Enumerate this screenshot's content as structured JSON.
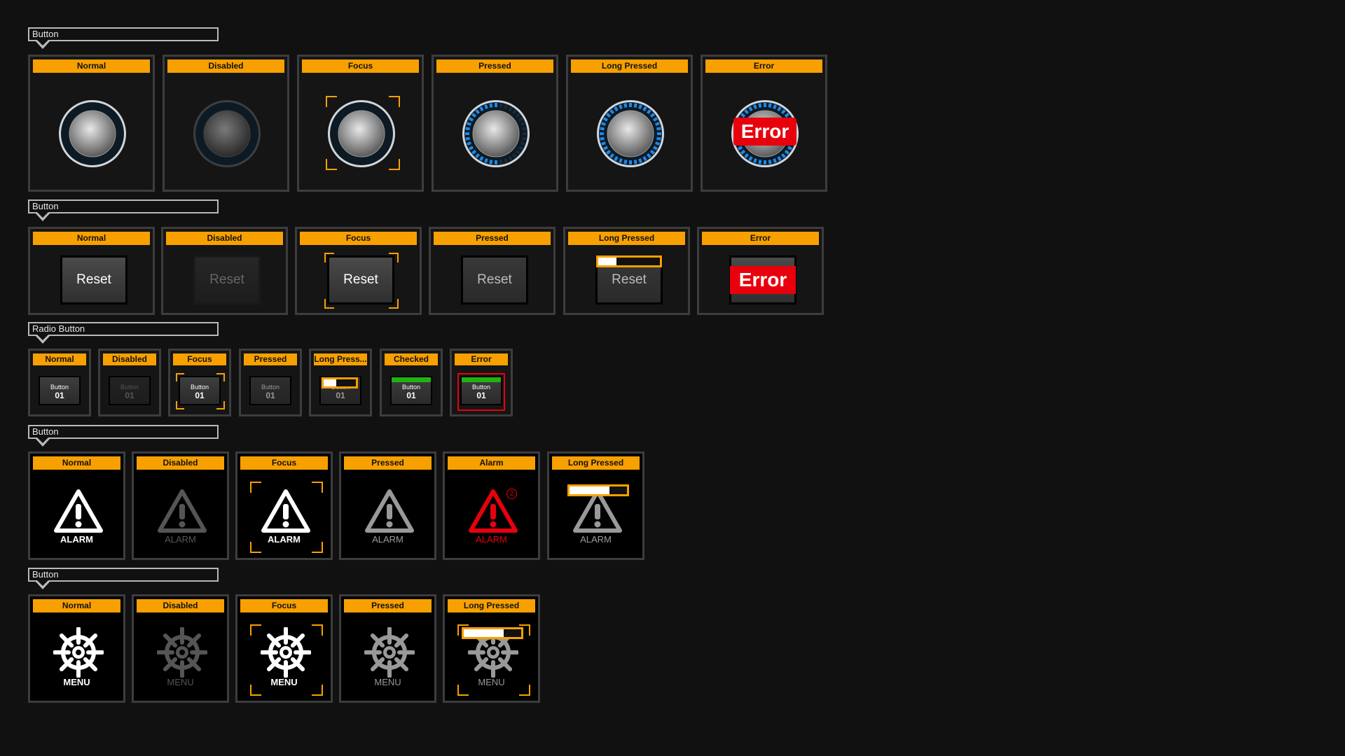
{
  "sections": [
    {
      "label": "Button"
    },
    {
      "label": "Button"
    },
    {
      "label": "Radio Button"
    },
    {
      "label": "Button"
    },
    {
      "label": "Button"
    }
  ],
  "knob_row": {
    "states": [
      "Normal",
      "Disabled",
      "Focus",
      "Pressed",
      "Long Pressed",
      "Error"
    ],
    "error_text": "Error"
  },
  "reset_row": {
    "states": [
      "Normal",
      "Disabled",
      "Focus",
      "Pressed",
      "Long Pressed",
      "Error"
    ],
    "button_label": "Reset",
    "error_text": "Error",
    "long_press_progress": 0.3
  },
  "radio_row": {
    "states": [
      "Normal",
      "Disabled",
      "Focus",
      "Pressed",
      "Long Press...",
      "Checked",
      "Error"
    ],
    "button_line1": "Button",
    "button_line2": "01",
    "long_press_progress": 0.4
  },
  "alarm_row": {
    "states": [
      "Normal",
      "Disabled",
      "Focus",
      "Pressed",
      "Alarm",
      "Long Pressed"
    ],
    "label": "ALARM",
    "alarm_count": "2",
    "long_press_progress": 0.7
  },
  "menu_row": {
    "states": [
      "Normal",
      "Disabled",
      "Focus",
      "Pressed",
      "Long Pressed"
    ],
    "label": "MENU",
    "long_press_progress": 0.7
  },
  "colors": {
    "accent": "#f7a000",
    "error": "#e8000d",
    "checked": "#1fb312",
    "knob_ring": "#1e88e5"
  }
}
